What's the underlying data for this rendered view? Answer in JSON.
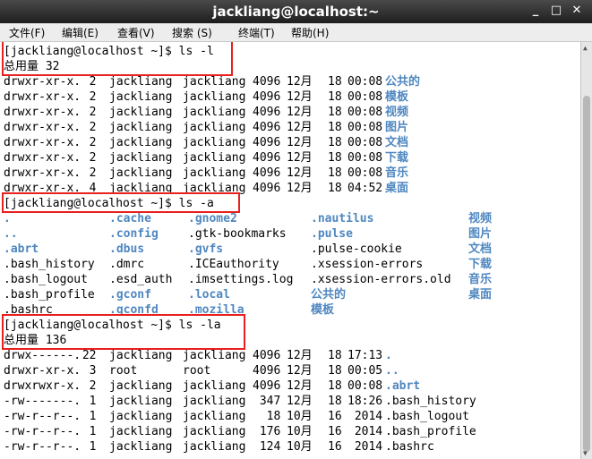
{
  "window": {
    "title": "jackliang@localhost:~",
    "minimize_glyph": "_",
    "maximize_glyph": "□",
    "close_glyph": "✕"
  },
  "menu": [
    "文件(F)",
    "编辑(E)",
    "查看(V)",
    "搜索 (S)",
    "终端(T)",
    "帮助(H)"
  ],
  "colors": {
    "directory": "#4f87c0",
    "highlight_box": "#e8201e"
  },
  "terminal": {
    "prompt1": "[jackliang@localhost ~]$ ls -l",
    "total1": "总用量 32",
    "listing1": [
      {
        "perm": "drwxr-xr-x.",
        "links": "2",
        "owner": "jackliang",
        "group": "jackliang",
        "size": "4096",
        "month": "12月",
        "day": "18",
        "time": "00:08",
        "name": "公共的"
      },
      {
        "perm": "drwxr-xr-x.",
        "links": "2",
        "owner": "jackliang",
        "group": "jackliang",
        "size": "4096",
        "month": "12月",
        "day": "18",
        "time": "00:08",
        "name": "模板"
      },
      {
        "perm": "drwxr-xr-x.",
        "links": "2",
        "owner": "jackliang",
        "group": "jackliang",
        "size": "4096",
        "month": "12月",
        "day": "18",
        "time": "00:08",
        "name": "视频"
      },
      {
        "perm": "drwxr-xr-x.",
        "links": "2",
        "owner": "jackliang",
        "group": "jackliang",
        "size": "4096",
        "month": "12月",
        "day": "18",
        "time": "00:08",
        "name": "图片"
      },
      {
        "perm": "drwxr-xr-x.",
        "links": "2",
        "owner": "jackliang",
        "group": "jackliang",
        "size": "4096",
        "month": "12月",
        "day": "18",
        "time": "00:08",
        "name": "文档"
      },
      {
        "perm": "drwxr-xr-x.",
        "links": "2",
        "owner": "jackliang",
        "group": "jackliang",
        "size": "4096",
        "month": "12月",
        "day": "18",
        "time": "00:08",
        "name": "下载"
      },
      {
        "perm": "drwxr-xr-x.",
        "links": "2",
        "owner": "jackliang",
        "group": "jackliang",
        "size": "4096",
        "month": "12月",
        "day": "18",
        "time": "00:08",
        "name": "音乐"
      },
      {
        "perm": "drwxr-xr-x.",
        "links": "4",
        "owner": "jackliang",
        "group": "jackliang",
        "size": "4096",
        "month": "12月",
        "day": "18",
        "time": "04:52",
        "name": "桌面"
      }
    ],
    "prompt2": "[jackliang@localhost ~]$ ls -a",
    "grid": [
      [
        {
          "t": ".",
          "d": true
        },
        {
          "t": ".cache",
          "d": true
        },
        {
          "t": ".gnome2",
          "d": true
        },
        {
          "t": ".nautilus",
          "d": true
        },
        {
          "t": "视频",
          "d": true
        }
      ],
      [
        {
          "t": "..",
          "d": true
        },
        {
          "t": ".config",
          "d": true
        },
        {
          "t": ".gtk-bookmarks",
          "d": false
        },
        {
          "t": ".pulse",
          "d": true
        },
        {
          "t": "图片",
          "d": true
        }
      ],
      [
        {
          "t": ".abrt",
          "d": true
        },
        {
          "t": ".dbus",
          "d": true
        },
        {
          "t": ".gvfs",
          "d": true
        },
        {
          "t": ".pulse-cookie",
          "d": false
        },
        {
          "t": "文档",
          "d": true
        }
      ],
      [
        {
          "t": ".bash_history",
          "d": false
        },
        {
          "t": ".dmrc",
          "d": false
        },
        {
          "t": ".ICEauthority",
          "d": false
        },
        {
          "t": ".xsession-errors",
          "d": false
        },
        {
          "t": "下载",
          "d": true
        }
      ],
      [
        {
          "t": ".bash_logout",
          "d": false
        },
        {
          "t": ".esd_auth",
          "d": false
        },
        {
          "t": ".imsettings.log",
          "d": false
        },
        {
          "t": ".xsession-errors.old",
          "d": false
        },
        {
          "t": "音乐",
          "d": true
        }
      ],
      [
        {
          "t": ".bash_profile",
          "d": false
        },
        {
          "t": ".gconf",
          "d": true
        },
        {
          "t": ".local",
          "d": true
        },
        {
          "t": "公共的",
          "d": true
        },
        {
          "t": "桌面",
          "d": true
        }
      ],
      [
        {
          "t": ".bashrc",
          "d": false
        },
        {
          "t": ".gconfd",
          "d": true
        },
        {
          "t": ".mozilla",
          "d": true
        },
        {
          "t": "模板",
          "d": true
        },
        {
          "t": "",
          "d": false
        }
      ]
    ],
    "prompt3": "[jackliang@localhost ~]$ ls -la",
    "total3": "总用量 136",
    "listing3": [
      {
        "perm": "drwx------.",
        "links": "22",
        "owner": "jackliang",
        "group": "jackliang",
        "size": "4096",
        "month": "12月",
        "day": "18",
        "time": "17:13",
        "name": ".",
        "dir": true
      },
      {
        "perm": "drwxr-xr-x.",
        "links": "3",
        "owner": "root",
        "group": "root",
        "size": "4096",
        "month": "12月",
        "day": "18",
        "time": "00:05",
        "name": "..",
        "dir": true
      },
      {
        "perm": "drwxrwxr-x.",
        "links": "2",
        "owner": "jackliang",
        "group": "jackliang",
        "size": "4096",
        "month": "12月",
        "day": "18",
        "time": "00:08",
        "name": ".abrt",
        "dir": true
      },
      {
        "perm": "-rw-------.",
        "links": "1",
        "owner": "jackliang",
        "group": "jackliang",
        "size": "347",
        "month": "12月",
        "day": "18",
        "time": "18:26",
        "name": ".bash_history",
        "dir": false
      },
      {
        "perm": "-rw-r--r--.",
        "links": "1",
        "owner": "jackliang",
        "group": "jackliang",
        "size": "18",
        "month": "10月",
        "day": "16",
        "time": "2014",
        "name": ".bash_logout",
        "dir": false
      },
      {
        "perm": "-rw-r--r--.",
        "links": "1",
        "owner": "jackliang",
        "group": "jackliang",
        "size": "176",
        "month": "10月",
        "day": "16",
        "time": "2014",
        "name": ".bash_profile",
        "dir": false
      },
      {
        "perm": "-rw-r--r--.",
        "links": "1",
        "owner": "jackliang",
        "group": "jackliang",
        "size": "124",
        "month": "10月",
        "day": "16",
        "time": "2014",
        "name": ".bashrc",
        "dir": false
      }
    ]
  }
}
